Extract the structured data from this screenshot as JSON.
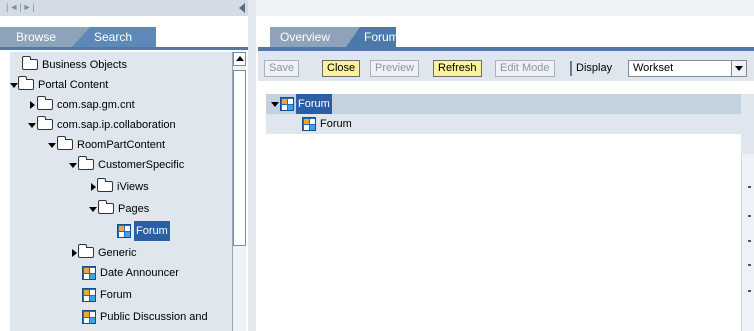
{
  "topbar": {
    "nav_arrows": "|◄|►|"
  },
  "left_panel": {
    "tabs": [
      {
        "label": "Browse"
      },
      {
        "label": "Search"
      }
    ],
    "tree": [
      {
        "label": "Business Objects",
        "icon": "folder-icon"
      },
      {
        "label": "Portal Content",
        "icon": "folder-icon",
        "expanded": true
      },
      {
        "label": "com.sap.gm.cnt",
        "icon": "folder-icon"
      },
      {
        "label": "com.sap.ip.collaboration",
        "icon": "folder-icon",
        "expanded": true
      },
      {
        "label": "RoomPartContent",
        "icon": "folder-icon",
        "expanded": true
      },
      {
        "label": "CustomerSpecific",
        "icon": "folder-icon",
        "expanded": true
      },
      {
        "label": "iViews",
        "icon": "folder-icon"
      },
      {
        "label": "Pages",
        "icon": "folder-icon",
        "expanded": true
      },
      {
        "label": "Forum",
        "icon": "page-icon",
        "selected": true
      },
      {
        "label": "Generic",
        "icon": "folder-icon"
      },
      {
        "label": "Date Announcer",
        "icon": "iview-icon"
      },
      {
        "label": "Forum",
        "icon": "iview-icon"
      },
      {
        "label": "Public Discussion and",
        "icon": "iview-icon"
      }
    ]
  },
  "right_panel": {
    "tabs": [
      {
        "label": "Overview"
      },
      {
        "label": "Forum"
      }
    ],
    "toolbar": {
      "save": "Save",
      "close": "Close",
      "preview": "Preview",
      "refresh": "Refresh",
      "edit_mode": "Edit Mode",
      "display_label": "Display",
      "display_value": "Workset"
    },
    "content_tree": [
      {
        "label": "Forum",
        "icon": "page-icon"
      },
      {
        "label": "Forum",
        "icon": "page-icon"
      }
    ]
  },
  "colors": {
    "tab_active": "#4c79aa",
    "tab_inactive": "#8ea3ba",
    "button_active": "#fbf29a",
    "tree_bg": "#dfe6ee",
    "selection": "#2a5fa6"
  }
}
